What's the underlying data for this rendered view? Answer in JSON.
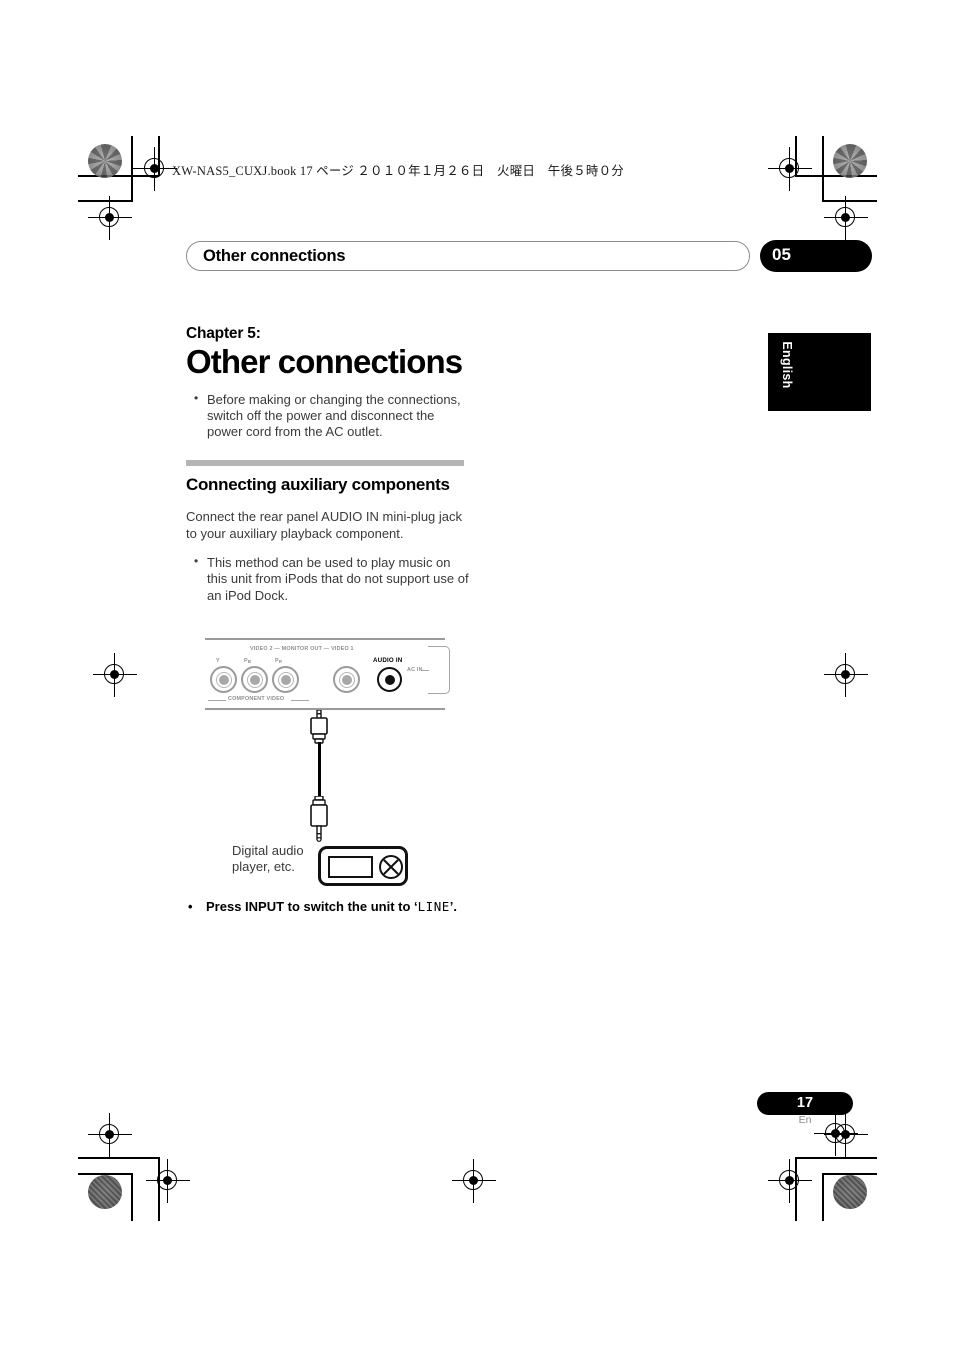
{
  "print_marks": {
    "file_header": "XW-NAS5_CUXJ.book  17 ページ  ２０１０年１月２６日　火曜日　午後５時０分"
  },
  "header": {
    "running_title": "Other connections",
    "chapter_number": "05"
  },
  "language_tab": {
    "label": "English"
  },
  "main": {
    "chapter_eyebrow": "Chapter 5:",
    "chapter_title": "Other connections",
    "intro_bullets": [
      "Before making or changing the connections, switch off the power and disconnect the power cord from the AC outlet."
    ],
    "section": {
      "title": "Connecting auxiliary components",
      "paragraph": "Connect the rear panel AUDIO IN mini-plug jack to your auxiliary playback component.",
      "bullets": [
        "This method can be used to play music on this unit from iPods that do not support use of an iPod Dock."
      ]
    },
    "final_note": {
      "bullet": "•",
      "text_before": "Press INPUT to switch the unit to ‘",
      "lcd_value": "LINE",
      "text_after": "’."
    }
  },
  "diagram": {
    "labels": {
      "monitor_out": "VIDEO 2 — MONITOR OUT — VIDEO 1",
      "component_video": "COMPONENT VIDEO",
      "y": "Y",
      "pb": "P",
      "pb_sub": "B",
      "pr": "P",
      "pr_sub": "R",
      "audio_in": "AUDIO IN",
      "ac_in": "AC IN"
    },
    "device_caption": "Digital audio player, etc."
  },
  "footer": {
    "page_number": "17",
    "language_code": "En"
  },
  "colors": {
    "accent_black": "#000000",
    "rule_grey": "#b4b4b4",
    "body_grey": "#3a3a3a",
    "panel_grey": "#9b9b9b"
  }
}
